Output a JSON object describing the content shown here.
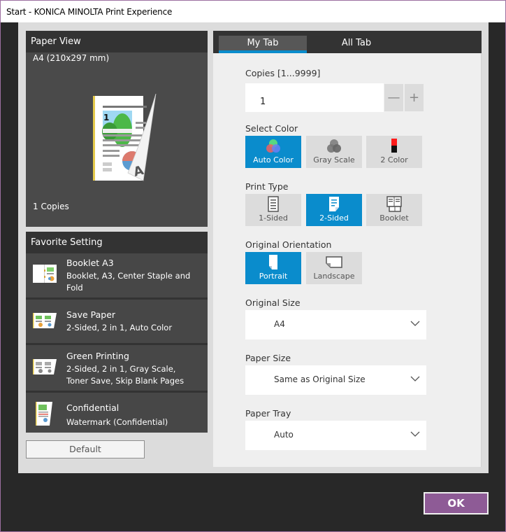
{
  "window": {
    "title": "Start - KONICA MINOLTA Print Experience"
  },
  "paper_view": {
    "header": "Paper View",
    "paper_size": "A4 (210x297 mm)",
    "copies_text": "1 Copies",
    "preview_page_number": "1"
  },
  "favorites": {
    "header": "Favorite Setting",
    "items": [
      {
        "name": "Booklet A3",
        "desc": "Booklet, A3, Center Staple and Fold",
        "icon": "booklet-icon"
      },
      {
        "name": "Save Paper",
        "desc": "2-Sided, 2 in 1, Auto Color",
        "icon": "save-paper-icon"
      },
      {
        "name": "Green Printing",
        "desc": "2-Sided, 2 in 1, Gray Scale, Toner Save, Skip Blank Pages",
        "icon": "green-printing-icon"
      },
      {
        "name": "Confidential",
        "desc": "Watermark (Confidential)",
        "icon": "confidential-icon"
      }
    ]
  },
  "default_button": "Default",
  "tabs": [
    {
      "label": "My Tab",
      "active": true
    },
    {
      "label": "All Tab",
      "active": false
    }
  ],
  "settings": {
    "copies": {
      "label": "Copies  [1...9999]",
      "value": "1",
      "minus": "—",
      "plus": "+"
    },
    "select_color": {
      "label": "Select Color",
      "options": [
        {
          "label": "Auto Color",
          "selected": true
        },
        {
          "label": "Gray Scale",
          "selected": false
        },
        {
          "label": "2 Color",
          "selected": false
        }
      ]
    },
    "print_type": {
      "label": "Print Type",
      "options": [
        {
          "label": "1-Sided",
          "selected": false
        },
        {
          "label": "2-Sided",
          "selected": true
        },
        {
          "label": "Booklet",
          "selected": false
        }
      ]
    },
    "orientation": {
      "label": "Original Orientation",
      "options": [
        {
          "label": "Portrait",
          "selected": true
        },
        {
          "label": "Landscape",
          "selected": false
        }
      ]
    },
    "original_size": {
      "label": "Original Size",
      "value": "A4"
    },
    "paper_size": {
      "label": "Paper Size",
      "value": "Same as Original Size"
    },
    "paper_tray": {
      "label": "Paper Tray",
      "value": "Auto"
    }
  },
  "ok_button": "OK",
  "colors": {
    "accent_blue": "#0a8ccc",
    "ok_purple": "#8e5b96",
    "panel_dark": "#333333",
    "panel_mid": "#4a4a4a"
  }
}
